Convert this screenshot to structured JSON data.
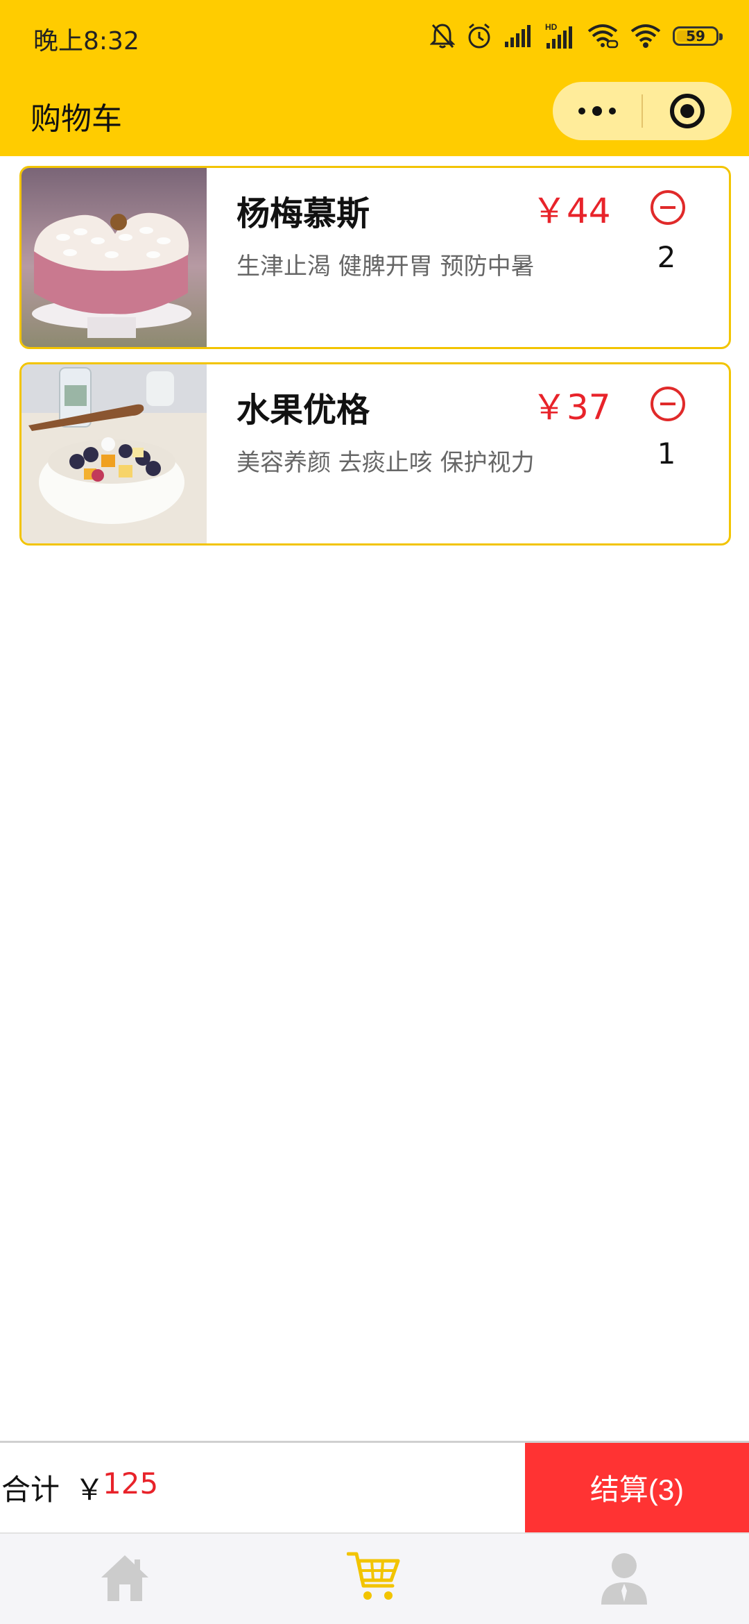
{
  "status_bar": {
    "time": "晚上8:32",
    "battery_level": 59,
    "battery_text": "59",
    "icons": [
      "bell-muted-icon",
      "alarm-icon",
      "signal-icon",
      "hd-signal-icon",
      "wifi-link-icon",
      "wifi-icon",
      "battery-icon"
    ]
  },
  "nav": {
    "title": "购物车",
    "more_icon": "more-dots-icon",
    "close_icon": "target-circle-icon"
  },
  "cart": {
    "items": [
      {
        "name": "杨梅慕斯",
        "price": "￥44",
        "description": "生津止渴 健脾开胃 预防中暑",
        "quantity": "2",
        "image": "bayberry-mousse-cake"
      },
      {
        "name": "水果优格",
        "price": "￥37",
        "description": "美容养颜 去痰止咳 保护视力",
        "quantity": "1",
        "image": "fruit-yogurt-bowl"
      }
    ]
  },
  "checkout": {
    "total_label": "合计",
    "currency": "￥",
    "total_value": "125",
    "button_label": "结算(3)"
  },
  "tabbar": {
    "tabs": [
      {
        "icon": "home-icon",
        "active": false
      },
      {
        "icon": "shopping-cart-icon",
        "active": true
      },
      {
        "icon": "user-icon",
        "active": false
      }
    ]
  },
  "colors": {
    "primary_yellow": "#ffcc00",
    "price_red": "#e8232a",
    "checkout_red": "#ff3333",
    "tab_active": "#f2c400",
    "tab_inactive": "#cccccc"
  }
}
